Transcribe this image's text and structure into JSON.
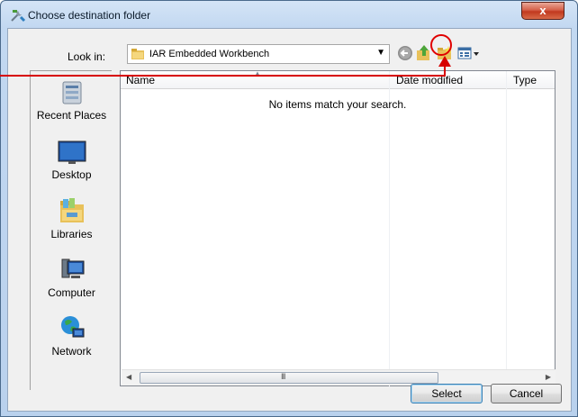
{
  "window": {
    "title": "Choose destination folder",
    "close_label": "x"
  },
  "lookin": {
    "label": "Look in:",
    "value": "IAR Embedded Workbench"
  },
  "toolbar": {
    "icons": [
      "back-icon",
      "up-folder-icon",
      "new-folder-icon",
      "view-menu-icon"
    ]
  },
  "places": [
    {
      "label": "Recent Places",
      "icon": "recent-places-icon"
    },
    {
      "label": "Desktop",
      "icon": "desktop-icon"
    },
    {
      "label": "Libraries",
      "icon": "libraries-icon"
    },
    {
      "label": "Computer",
      "icon": "computer-icon"
    },
    {
      "label": "Network",
      "icon": "network-icon"
    }
  ],
  "filelist": {
    "columns": [
      "Name",
      "Date modified",
      "Type"
    ],
    "empty_message": "No items match your search.",
    "scroll_grip": "III"
  },
  "buttons": {
    "select": "Select",
    "cancel": "Cancel"
  },
  "colors": {
    "annotation": "#d70000",
    "title_bar": "#c2d8f1",
    "close_button": "#c1391f"
  }
}
